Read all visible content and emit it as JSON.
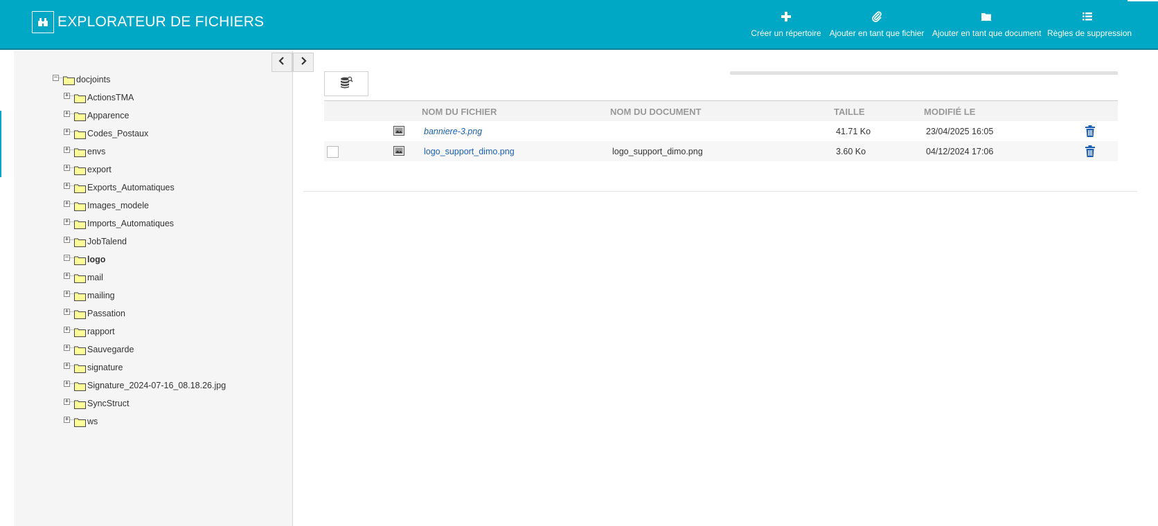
{
  "header": {
    "title": "EXPLORATEUR DE FICHIERS",
    "logo_icon": "binoculars-icon",
    "actions": [
      {
        "label": "Créer un répertoire",
        "icon": "plus-icon"
      },
      {
        "label": "Ajouter en tant que fichier",
        "icon": "paperclip-icon"
      },
      {
        "label": "Ajouter en tant que document",
        "icon": "folder-icon"
      },
      {
        "label": "Règles de suppression",
        "icon": "list-icon"
      }
    ],
    "colors": {
      "background": "#00a8c6",
      "text": "#ffffff"
    }
  },
  "sidebar": {
    "nav": {
      "prev_icon": "chevron-left-icon",
      "next_icon": "chevron-right-icon"
    },
    "tree": {
      "root": {
        "label": "docjoints",
        "expanded": true
      },
      "children": [
        {
          "label": "ActionsTMA",
          "expanded": false
        },
        {
          "label": "Apparence",
          "expanded": false
        },
        {
          "label": "Codes_Postaux",
          "expanded": false
        },
        {
          "label": "envs",
          "expanded": false
        },
        {
          "label": "export",
          "expanded": false
        },
        {
          "label": "Exports_Automatiques",
          "expanded": false
        },
        {
          "label": "Images_modele",
          "expanded": false
        },
        {
          "label": "Imports_Automatiques",
          "expanded": false
        },
        {
          "label": "JobTalend",
          "expanded": false
        },
        {
          "label": "logo",
          "expanded": true,
          "selected": true
        },
        {
          "label": "mail",
          "expanded": false
        },
        {
          "label": "mailing",
          "expanded": false
        },
        {
          "label": "Passation",
          "expanded": false
        },
        {
          "label": "rapport",
          "expanded": false
        },
        {
          "label": "Sauvegarde",
          "expanded": false
        },
        {
          "label": "signature",
          "expanded": false
        },
        {
          "label": "Signature_2024-07-16_08.18.26.jpg",
          "expanded": false
        },
        {
          "label": "SyncStruct",
          "expanded": false
        },
        {
          "label": "ws",
          "expanded": false
        }
      ]
    }
  },
  "main": {
    "toolbar": {
      "search_icon": "database-search-icon"
    },
    "table": {
      "columns": {
        "filename": "NOM DU FICHIER",
        "document": "NOM DU DOCUMENT",
        "size": "TAILLE",
        "modified": "MODIFIÉ LE"
      },
      "rows": [
        {
          "filename": "banniere-3.png",
          "document": "",
          "size": "41.71 Ko",
          "modified": "23/04/2025 16:05",
          "has_checkbox": false,
          "italic": true
        },
        {
          "filename": "logo_support_dimo.png",
          "document": "logo_support_dimo.png",
          "size": "3.60 Ko",
          "modified": "04/12/2024 17:06",
          "has_checkbox": true,
          "italic": false
        }
      ]
    },
    "colors": {
      "link": "#1a5fb4",
      "trash": "#1a5fb4"
    }
  }
}
